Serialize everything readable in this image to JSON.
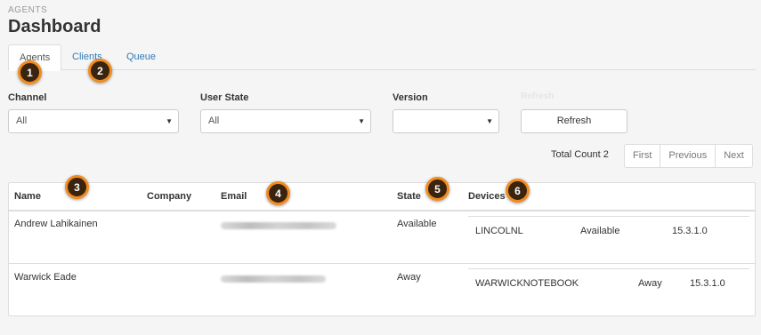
{
  "breadcrumb": "AGENTS",
  "title": "Dashboard",
  "tabs": [
    {
      "label": "Agents",
      "active": true
    },
    {
      "label": "Clients",
      "active": false
    },
    {
      "label": "Queue",
      "active": false
    }
  ],
  "markers": [
    "1",
    "2",
    "3",
    "4",
    "5",
    "6"
  ],
  "filters": {
    "channel": {
      "label": "Channel",
      "value": "All"
    },
    "user_state": {
      "label": "User State",
      "value": "All"
    },
    "version": {
      "label": "Version",
      "value": ""
    },
    "refresh_hint": "Refresh",
    "refresh_label": "Refresh"
  },
  "total_count": "Total Count 2",
  "pager": {
    "first": "First",
    "previous": "Previous",
    "next": "Next"
  },
  "table": {
    "headers": {
      "name": "Name",
      "company": "Company",
      "email": "Email",
      "state": "State",
      "devices": "Devices"
    },
    "rows": [
      {
        "name": "Andrew Lahikainen",
        "company": "",
        "state": "Available",
        "devices": [
          {
            "name": "LINCOLNL",
            "state": "Available",
            "version": "15.3.1.0"
          }
        ]
      },
      {
        "name": "Warwick Eade",
        "company": "",
        "state": "Away",
        "devices": [
          {
            "name": "WARWICKNOTEBOOK",
            "state": "Away",
            "version": "15.3.1.0"
          }
        ]
      }
    ]
  },
  "colors": {
    "link": "#337ab7",
    "marker_fill": "#3a2410",
    "marker_border": "#f28c1e"
  }
}
